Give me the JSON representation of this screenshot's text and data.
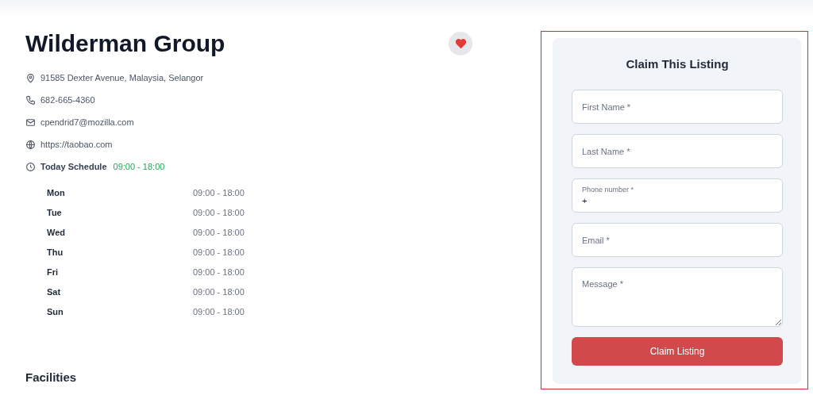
{
  "listing": {
    "title": "Wilderman Group",
    "favorited": true,
    "contacts": [
      {
        "kind": "address",
        "text": "91585 Dexter Avenue, Malaysia, Selangor"
      },
      {
        "kind": "phone",
        "text": "682-665-4360"
      },
      {
        "kind": "email",
        "text": "cpendrid7@mozilla.com"
      },
      {
        "kind": "website",
        "text": "https://taobao.com"
      }
    ],
    "today_schedule": {
      "label": "Today Schedule",
      "hours": "09:00 - 18:00"
    },
    "schedule": [
      {
        "day": "Mon",
        "hours": "09:00 - 18:00"
      },
      {
        "day": "Tue",
        "hours": "09:00 - 18:00"
      },
      {
        "day": "Wed",
        "hours": "09:00 - 18:00"
      },
      {
        "day": "Thu",
        "hours": "09:00 - 18:00"
      },
      {
        "day": "Fri",
        "hours": "09:00 - 18:00"
      },
      {
        "day": "Sat",
        "hours": "09:00 - 18:00"
      },
      {
        "day": "Sun",
        "hours": "09:00 - 18:00"
      }
    ],
    "facilities_heading": "Facilities"
  },
  "claim_form": {
    "title": "Claim This Listing",
    "fields": [
      {
        "kind": "text",
        "placeholder": "First Name *"
      },
      {
        "kind": "text",
        "placeholder": "Last Name *"
      },
      {
        "kind": "phone",
        "label": "Phone number *",
        "value": "+"
      },
      {
        "kind": "text",
        "placeholder": "Email *"
      },
      {
        "kind": "textarea",
        "placeholder": "Message *"
      }
    ],
    "button": "Claim Listing"
  }
}
